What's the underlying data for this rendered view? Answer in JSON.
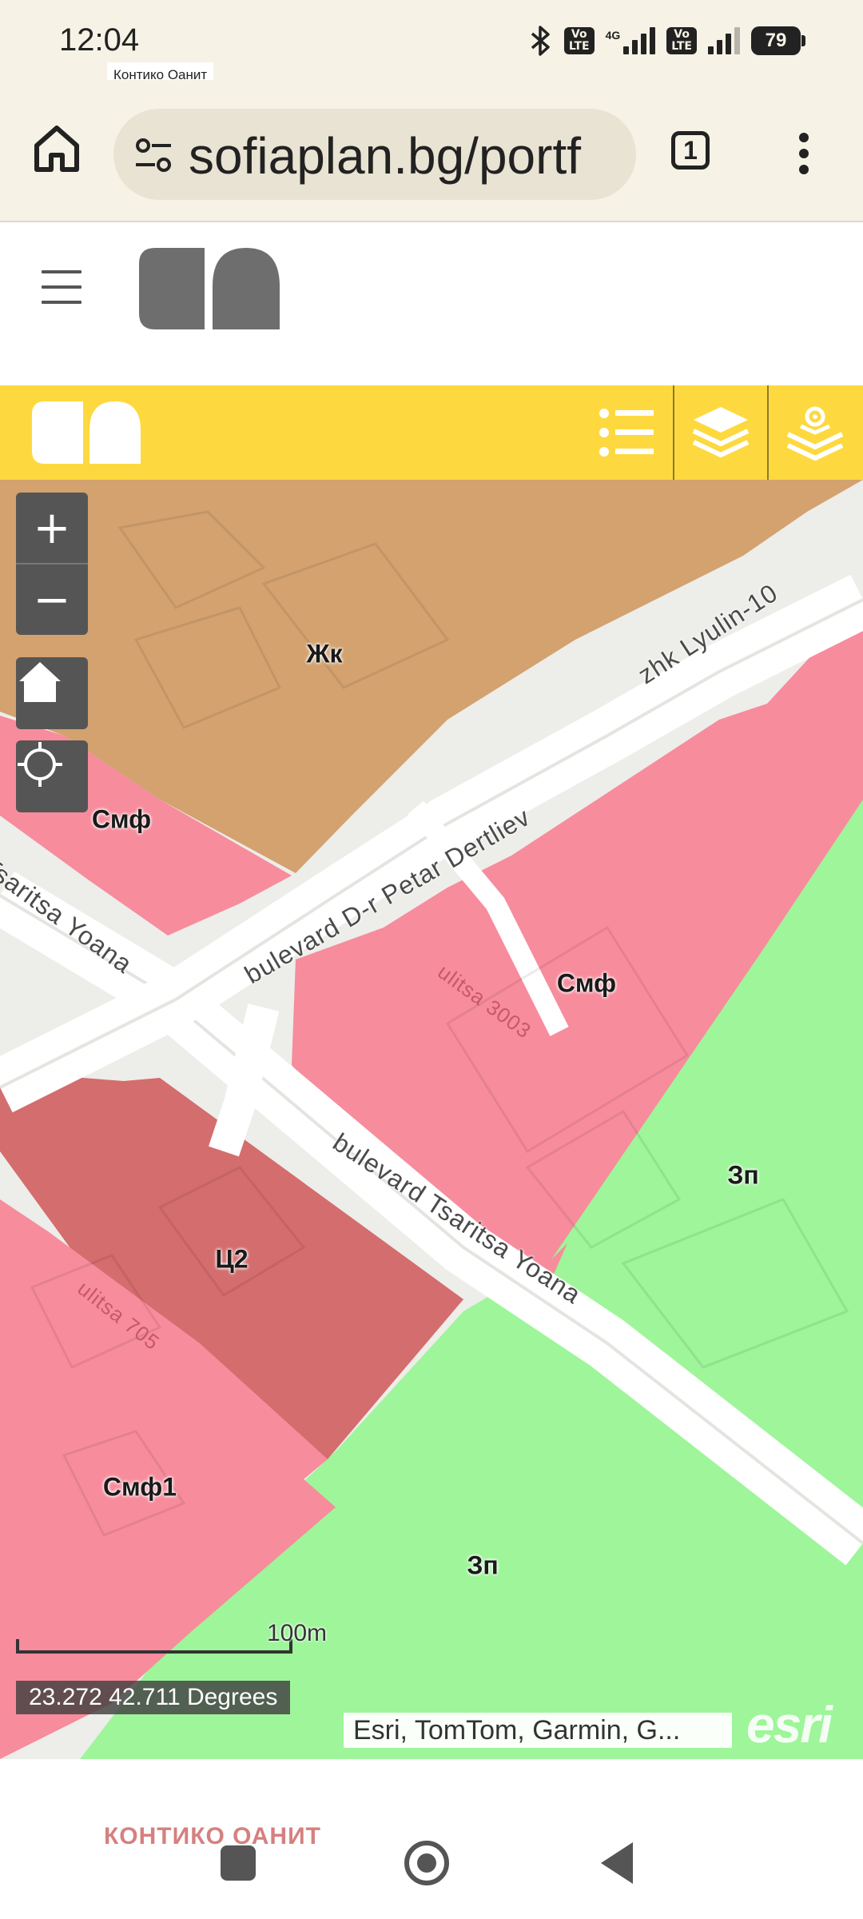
{
  "status_bar": {
    "time": "12:04",
    "volte1": "Vo LTE",
    "network": "4G",
    "volte2": "Vo LTE",
    "battery": "79"
  },
  "tooltip": "Контико Оанит",
  "browser": {
    "url": "sofiaplan.bg/portf",
    "tab_count": "1"
  },
  "map": {
    "zones": [
      {
        "label": "Жк",
        "color": "#d3a26f"
      },
      {
        "label": "Смф",
        "color": "#f78c9c"
      },
      {
        "label": "Смф",
        "color": "#f78c9c"
      },
      {
        "label": "Ц2",
        "color": "#d46d6d"
      },
      {
        "label": "Смф1",
        "color": "#f78c9c"
      },
      {
        "label": "Зп",
        "color": "#9ef59a"
      },
      {
        "label": "Зп",
        "color": "#9ef59a"
      }
    ],
    "roads": [
      "zhk Lyulin-10",
      "bulevard D-r Petar Dertliev",
      "d Tsaritsa Yoana",
      "bulevard Tsaritsa Yoana"
    ],
    "streets": [
      "ulitsa 3003",
      "ulitsa 705"
    ],
    "zoom_in": "+",
    "zoom_out": "−",
    "scale": "100m",
    "coordinates": "23.272 42.711 Degrees",
    "attribution": "Esri, TomTom, Garmin, G...",
    "esri_logo": "esri"
  },
  "footer": {
    "text": "КОНТИКО ОАНИТ"
  },
  "colors": {
    "toolbar": "#fdd93f",
    "residential": "#d3a26f",
    "mixed": "#f78c9c",
    "central": "#d46d6d",
    "green": "#9ef59a"
  }
}
